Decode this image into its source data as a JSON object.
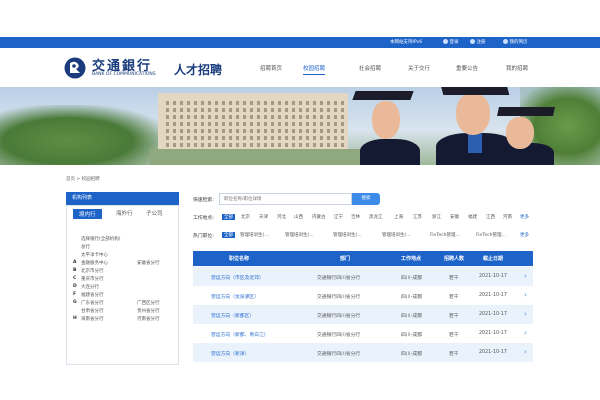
{
  "topbar": {
    "ipv6": "本网站支持IPv6",
    "login": "登录",
    "register": "注册",
    "my_account": "我的简历"
  },
  "header": {
    "brand_cn": "交通銀行",
    "brand_en": "BANK OF COMMUNICATIONS",
    "brand_suffix": "人才招聘",
    "nav": [
      "招聘首页",
      "校园招聘",
      "社会招聘",
      "关于交行",
      "重要公告",
      "我的招聘"
    ],
    "active_nav": 1
  },
  "breadcrumb": "首页 > 校园招聘",
  "sidebar": {
    "title": "机构列表",
    "tabs": [
      "境内行",
      "海外行",
      "子公司"
    ],
    "items": [
      {
        "letter": "",
        "name": "选择银行(全部机构)",
        "name2": ""
      },
      {
        "letter": "",
        "name": "总行",
        "name2": ""
      },
      {
        "letter": "",
        "name": "太平洋卡中心",
        "name2": ""
      },
      {
        "letter": "A",
        "name": "金融服务中心",
        "name2": "安徽省分行"
      },
      {
        "letter": "B",
        "name": "北京市分行",
        "name2": ""
      },
      {
        "letter": "C",
        "name": "重庆市分行",
        "name2": ""
      },
      {
        "letter": "D",
        "name": "大连分行",
        "name2": ""
      },
      {
        "letter": "F",
        "name": "福建省分行",
        "name2": ""
      },
      {
        "letter": "G",
        "name": "广东省分行",
        "name2": "广西区分行"
      },
      {
        "letter": "",
        "name": "甘肃省分行",
        "name2": "贵州省分行"
      },
      {
        "letter": "H",
        "name": "海南省分行",
        "name2": "河南省分行"
      }
    ]
  },
  "search": {
    "label": "快速检索:",
    "placeholder": "职位名称/职位详情",
    "button": "搜索"
  },
  "filters": {
    "location_label": "工作地点:",
    "locations": [
      "全部",
      "北京",
      "天津",
      "河北",
      "山西",
      "内蒙古",
      "辽宁",
      "吉林",
      "黑龙江",
      "上海",
      "江苏",
      "浙江",
      "安徽",
      "福建",
      "江西",
      "河南"
    ],
    "location_more": "更多",
    "position_label": "热门职位:",
    "positions": [
      "全部",
      "管理培训生(…",
      "管理培训生(…",
      "管理培训生(…",
      "管理培训生(…",
      "FinTech管理…",
      "FinTech管理…"
    ],
    "position_more": "更多"
  },
  "table": {
    "headers": [
      "职位名称",
      "部门",
      "工作地点",
      "招聘人数",
      "截止日期"
    ],
    "rows": [
      {
        "title": "营运方向（市区及近郊）",
        "dept": "交通银行四川省分行",
        "location": "四川-成都",
        "count": "若干",
        "deadline": "2021-10-17"
      },
      {
        "title": "营运方向（龙泉驿区）",
        "dept": "交通银行四川省分行",
        "location": "四川-成都",
        "count": "若干",
        "deadline": "2021-10-17"
      },
      {
        "title": "营运方向（新都区）",
        "dept": "交通银行四川省分行",
        "location": "四川-成都",
        "count": "若干",
        "deadline": "2021-10-17"
      },
      {
        "title": "营运方向（新都、青白江）",
        "dept": "交通银行四川省分行",
        "location": "四川-成都",
        "count": "若干",
        "deadline": "2021-10-17"
      },
      {
        "title": "营运方向（新津）",
        "dept": "交通银行四川省分行",
        "location": "四川-成都",
        "count": "若干",
        "deadline": "2021-10-17"
      }
    ]
  },
  "colors": {
    "primary": "#1e64c8",
    "accent": "#3d8be8",
    "row_alt": "#eaf2fc",
    "brand": "#1a3c7c"
  }
}
